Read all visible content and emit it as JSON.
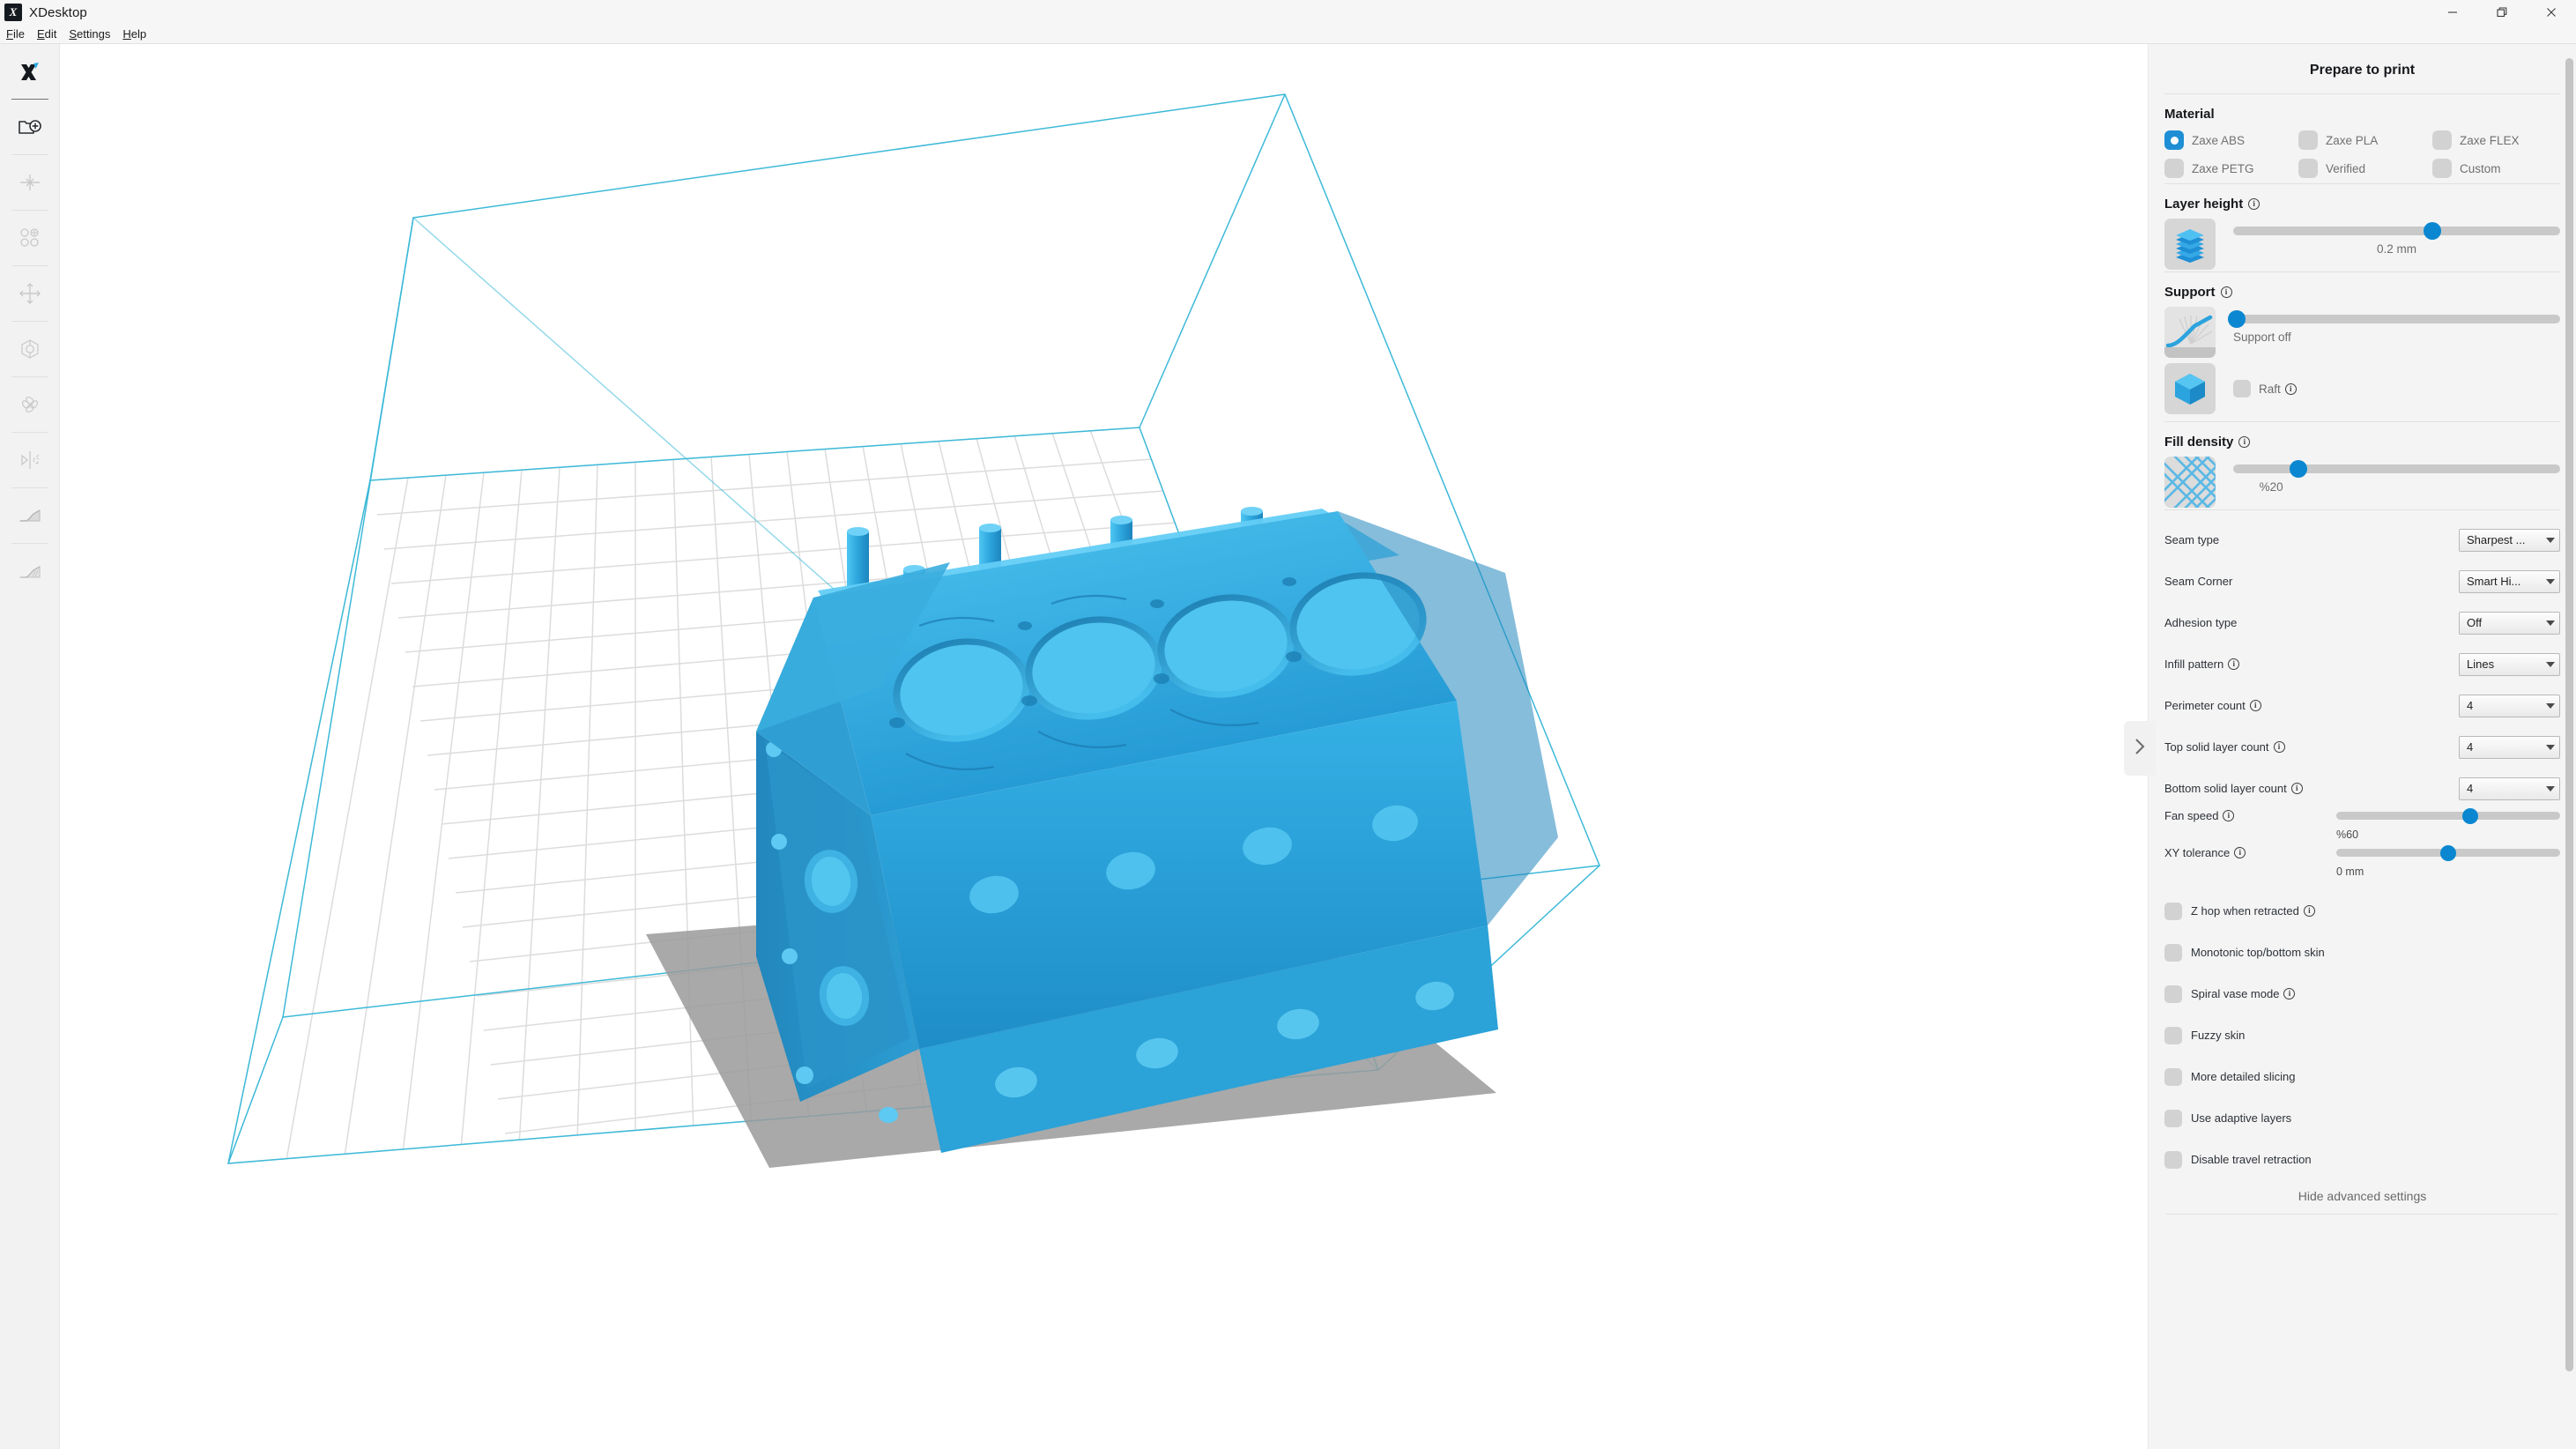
{
  "window": {
    "app_title": "XDesktop",
    "logo_glyph": "X",
    "controls": [
      {
        "name": "minimize",
        "label": "Minimize"
      },
      {
        "name": "restore",
        "label": "Restore"
      },
      {
        "name": "close",
        "label": "Close"
      }
    ]
  },
  "menubar": {
    "items": [
      {
        "label": "File",
        "accel": "F"
      },
      {
        "label": "Edit",
        "accel": "E"
      },
      {
        "label": "Settings",
        "accel": "S"
      },
      {
        "label": "Help",
        "accel": "H"
      }
    ]
  },
  "toolbar": {
    "logo": "X",
    "buttons": [
      {
        "icon": "open-file-add-icon",
        "label": "Add model"
      },
      {
        "icon": "center-model-icon",
        "label": "Center"
      },
      {
        "icon": "arrange-all-icon",
        "label": "Arrange all"
      },
      {
        "icon": "move-icon",
        "label": "Move"
      },
      {
        "icon": "scale-icon",
        "label": "Scale"
      },
      {
        "icon": "rotate-icon",
        "label": "Rotate"
      },
      {
        "icon": "mirror-icon",
        "label": "Mirror"
      },
      {
        "icon": "support-blocker-icon",
        "label": "Support blocker"
      },
      {
        "icon": "support-painter-icon",
        "label": "Support painter"
      }
    ]
  },
  "viewport": {
    "model_name": "engine-block-model",
    "model_color": "#29a8e0",
    "model_shadow_color": "#9c9c9c",
    "build_volume_color": "#3fb6d4",
    "grid_color": "#d8d8d8"
  },
  "panel": {
    "title": "Prepare to print",
    "collapse_icon": "chevron-right-icon",
    "material": {
      "heading": "Material",
      "options": [
        {
          "label": "Zaxe ABS",
          "selected": true
        },
        {
          "label": "Zaxe PLA",
          "selected": false
        },
        {
          "label": "Zaxe FLEX",
          "selected": false
        },
        {
          "label": "Zaxe PETG",
          "selected": false
        },
        {
          "label": "Verified",
          "selected": false
        },
        {
          "label": "Custom",
          "selected": false
        }
      ]
    },
    "layer_height": {
      "heading": "Layer height",
      "has_info": true,
      "value": "0.2 mm",
      "thumb_percent": 61,
      "tile_icon": "layer-stack-icon"
    },
    "support": {
      "heading": "Support",
      "has_info": true,
      "value": "Support off",
      "thumb_percent": 1,
      "tile_icon": "support-curve-icon",
      "raft": {
        "label": "Raft",
        "checked": false,
        "has_info": true,
        "tile_icon": "cube-icon"
      }
    },
    "fill_density": {
      "heading": "Fill density",
      "has_info": true,
      "value": "%20",
      "thumb_percent": 20,
      "tile_icon": "infill-grid-icon"
    },
    "advanced": {
      "selects": [
        {
          "label": "Seam type",
          "value": "Sharpest ...",
          "has_info": false
        },
        {
          "label": "Seam Corner",
          "value": "Smart Hi...",
          "has_info": false
        },
        {
          "label": "Adhesion type",
          "value": "Off",
          "has_info": false
        },
        {
          "label": "Infill pattern",
          "value": "Lines",
          "has_info": true
        },
        {
          "label": "Perimeter count",
          "value": "4",
          "has_info": true
        },
        {
          "label": "Top solid layer count",
          "value": "4",
          "has_info": true
        },
        {
          "label": "Bottom solid layer count",
          "value": "4",
          "has_info": true
        }
      ],
      "sliders": [
        {
          "label": "Fan speed",
          "value": "%60",
          "thumb_percent": 60,
          "has_info": true
        },
        {
          "label": "XY tolerance",
          "value": "0 mm",
          "thumb_percent": 50,
          "has_info": true
        }
      ],
      "checkboxes": [
        {
          "label": "Z hop when retracted",
          "checked": false,
          "has_info": true
        },
        {
          "label": "Monotonic top/bottom skin",
          "checked": false,
          "has_info": false
        },
        {
          "label": "Spiral vase mode",
          "checked": false,
          "has_info": true
        },
        {
          "label": "Fuzzy skin",
          "checked": false,
          "has_info": false
        },
        {
          "label": "More detailed slicing",
          "checked": false,
          "has_info": false
        },
        {
          "label": "Use adaptive layers",
          "checked": false,
          "has_info": false
        },
        {
          "label": "Disable travel retraction",
          "checked": false,
          "has_info": false
        }
      ],
      "hide_link": "Hide advanced settings"
    }
  },
  "colors": {
    "accent": "#0a87d0",
    "panel_bg": "#f4f4f4",
    "toolbar_bg": "#f2f2f2",
    "titlebar_bg": "#f6f6f6"
  }
}
